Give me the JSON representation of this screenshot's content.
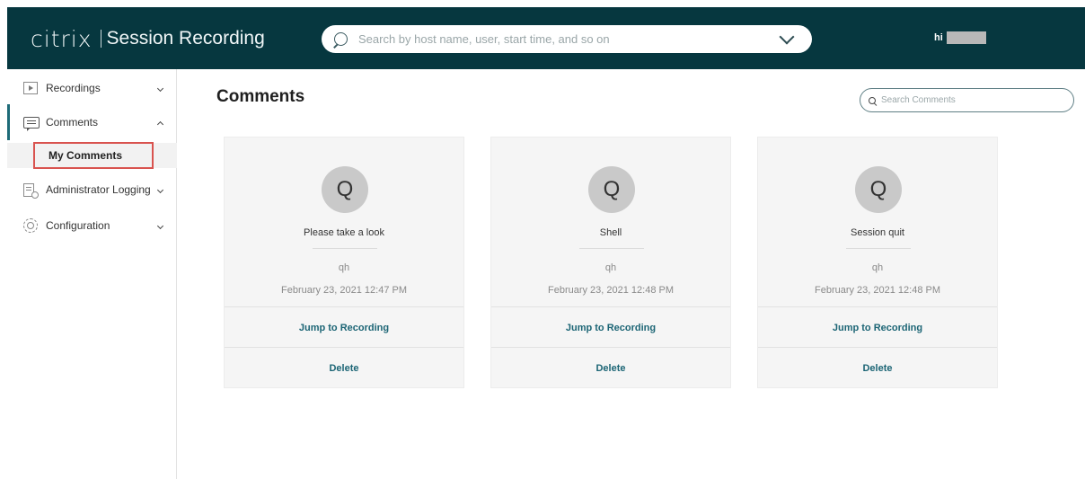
{
  "header": {
    "logo": "citrix",
    "product": "Session Recording",
    "search_placeholder": "Search by host name, user, start time, and so on",
    "greeting": "hi"
  },
  "sidebar": {
    "items": [
      {
        "label": "Recordings",
        "icon": "play-icon",
        "expanded": false
      },
      {
        "label": "Comments",
        "icon": "comment-icon",
        "expanded": true
      },
      {
        "label": "Administrator Logging",
        "icon": "admin-log-icon",
        "expanded": false
      },
      {
        "label": "Configuration",
        "icon": "gear-icon",
        "expanded": false
      }
    ],
    "sub_items": [
      {
        "label": "My Comments",
        "selected": true
      }
    ]
  },
  "main": {
    "title": "Comments",
    "search_placeholder": "Search Comments",
    "cards": [
      {
        "initial": "Q",
        "title": "Please take a look",
        "user": "qh",
        "date": "February 23, 2021 12:47 PM",
        "jump_label": "Jump to Recording",
        "delete_label": "Delete"
      },
      {
        "initial": "Q",
        "title": "Shell",
        "user": "qh",
        "date": "February 23, 2021 12:48 PM",
        "jump_label": "Jump to Recording",
        "delete_label": "Delete"
      },
      {
        "initial": "Q",
        "title": "Session quit",
        "user": "qh",
        "date": "February 23, 2021 12:48 PM",
        "jump_label": "Jump to Recording",
        "delete_label": "Delete"
      }
    ]
  },
  "colors": {
    "header_bg": "#06373f",
    "accent": "#1c6575",
    "highlight_box": "#d9534f",
    "card_bg": "#f5f5f5"
  }
}
